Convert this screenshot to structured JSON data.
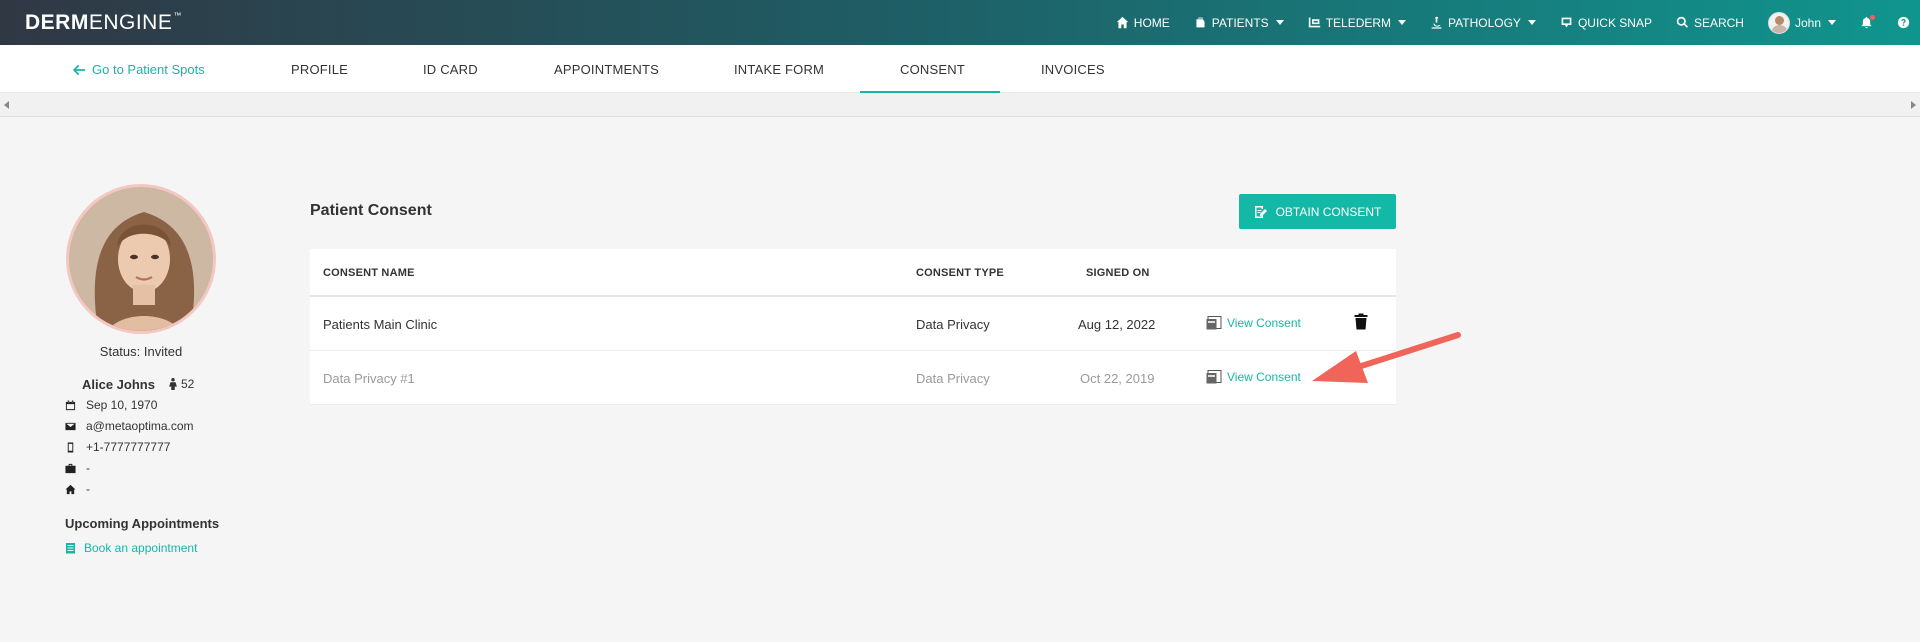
{
  "app": {
    "logo_bold": "DERM",
    "logo_light": "ENGINE",
    "logo_tm": "™"
  },
  "topnav": {
    "items": [
      {
        "label": "HOME",
        "icon": "home-icon"
      },
      {
        "label": "PATIENTS",
        "icon": "patients-icon",
        "dropdown": true
      },
      {
        "label": "TELEDERM",
        "icon": "telederm-icon",
        "dropdown": true
      },
      {
        "label": "PATHOLOGY",
        "icon": "microscope-icon",
        "dropdown": true
      },
      {
        "label": "QUICK SNAP",
        "icon": "quick-snap-icon"
      },
      {
        "label": "SEARCH",
        "icon": "search-icon"
      }
    ],
    "user": "John"
  },
  "subnav": {
    "back_label": "Go to Patient Spots",
    "tabs": [
      "PROFILE",
      "ID CARD",
      "APPOINTMENTS",
      "INTAKE FORM",
      "CONSENT",
      "INVOICES"
    ],
    "active_tab": "CONSENT"
  },
  "patient": {
    "status": "Status: Invited",
    "name": "Alice Johns",
    "age": "52",
    "dob": "Sep 10, 1970",
    "email": "a@metaoptima.com",
    "phone": "+1-7777777777",
    "work": "-",
    "home": "-",
    "upcoming_title": "Upcoming Appointments",
    "book_label": "Book an appointment"
  },
  "consent": {
    "title": "Patient Consent",
    "obtain_label": "OBTAIN CONSENT",
    "columns": [
      "CONSENT NAME",
      "CONSENT TYPE",
      "SIGNED ON"
    ],
    "rows": [
      {
        "name": "Patients Main Clinic",
        "type": "Data Privacy",
        "signed": "Aug 12, 2022",
        "action": "View Consent"
      },
      {
        "name": "Data Privacy #1",
        "type": "Data Privacy",
        "signed": "Oct 22, 2019",
        "action": "View Consent"
      }
    ]
  },
  "colors": {
    "accent": "#14b8a6",
    "annotation_arrow": "#f06459",
    "navbar_start": "#303844",
    "navbar_end": "#10958e"
  }
}
